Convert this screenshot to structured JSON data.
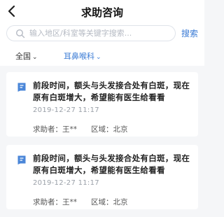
{
  "header": {
    "title": "求助咨询"
  },
  "search": {
    "placeholder": "输入地区/科室等关键字搜索...",
    "button_label": "搜索"
  },
  "filters": [
    {
      "label": "全国",
      "active": false
    },
    {
      "label": "耳鼻喉科",
      "active": true
    }
  ],
  "posts": [
    {
      "question": "前段时间，额头与头发接合处有白斑，现在原有白斑增大，希望能有医生给看看",
      "date": "2019-12-27  11:17",
      "asker_label": "求助者：王**",
      "region_label": "区域：北京"
    },
    {
      "question": "前段时间，额头与头发接合处有白斑，现在原有白斑增大，希望能有医生给看看",
      "date": "2019-12-27  11:17",
      "asker_label": "求助者：王**",
      "region_label": "区域：北京"
    }
  ],
  "colors": {
    "accent": "#3a7bd5",
    "background": "#f5f6f8"
  }
}
